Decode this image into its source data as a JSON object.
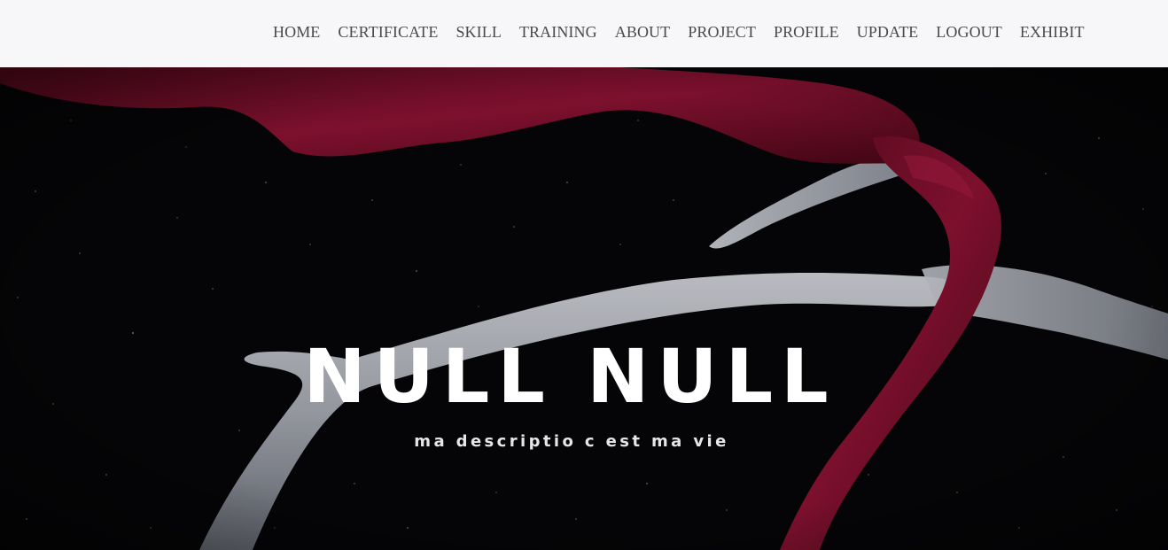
{
  "nav": {
    "items": [
      {
        "label": "HOME"
      },
      {
        "label": "CERTIFICATE"
      },
      {
        "label": "SKILL"
      },
      {
        "label": "TRAINING"
      },
      {
        "label": "ABOUT"
      },
      {
        "label": "PROJECT"
      },
      {
        "label": "PROFILE"
      },
      {
        "label": "UPDATE"
      },
      {
        "label": "LOGOUT"
      },
      {
        "label": "EXHIBIT"
      }
    ]
  },
  "hero": {
    "title": "NULL NULL",
    "subtitle": "ma descriptio c est ma vie",
    "image": "antlers-red-velvet-on-dark-starry-background"
  },
  "colors": {
    "navbar_bg": "#f7f7f9",
    "nav_text": "#4a4a4a",
    "hero_bg": "#060608",
    "velvet": "#8b0f2e",
    "antler": "#b9bcc4",
    "title": "#ffffff"
  }
}
